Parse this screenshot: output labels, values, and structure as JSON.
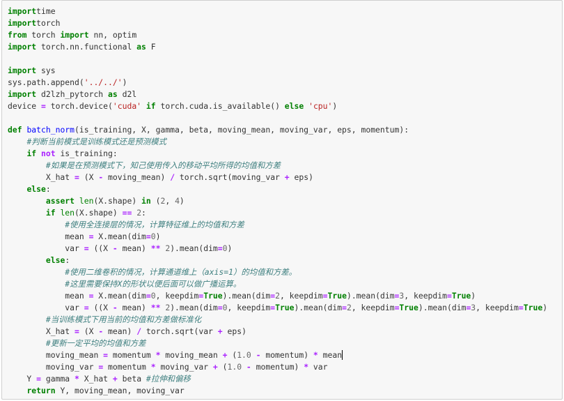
{
  "code_cell": {
    "lines": [
      [
        [
          "kw",
          "import"
        ],
        [
          "",
          "time"
        ]
      ],
      [
        [
          "kw",
          "import"
        ],
        [
          "",
          "torch"
        ]
      ],
      [
        [
          "kw",
          "from"
        ],
        [
          "",
          " torch "
        ],
        [
          "kw",
          "import"
        ],
        [
          "",
          " nn, optim"
        ]
      ],
      [
        [
          "kw",
          "import"
        ],
        [
          "",
          " torch.nn.functional "
        ],
        [
          "kw",
          "as"
        ],
        [
          "",
          " F"
        ]
      ],
      [],
      [
        [
          "kw",
          "import"
        ],
        [
          "",
          " sys"
        ]
      ],
      [
        [
          "",
          "sys.path.append("
        ],
        [
          "st",
          "'../../'"
        ],
        [
          "",
          ")"
        ]
      ],
      [
        [
          "kw",
          "import"
        ],
        [
          "",
          " d2lzh_pytorch "
        ],
        [
          "kw",
          "as"
        ],
        [
          "",
          " d2l"
        ]
      ],
      [
        [
          "",
          "device "
        ],
        [
          "op",
          "="
        ],
        [
          "",
          " torch.device("
        ],
        [
          "st",
          "'cuda'"
        ],
        [
          "",
          ""
        ],
        [
          "kw",
          " if"
        ],
        [
          "",
          " torch.cuda.is_available() "
        ],
        [
          "kw",
          "else"
        ],
        [
          "",
          " "
        ],
        [
          "st",
          "'cpu'"
        ],
        [
          "",
          ")"
        ]
      ],
      [],
      [
        [
          "kw",
          "def"
        ],
        [
          "",
          " "
        ],
        [
          "fn",
          "batch_norm"
        ],
        [
          "",
          "(is_training, X, gamma, beta, moving_mean, moving_var, eps, momentum):"
        ]
      ],
      [
        [
          "",
          "    "
        ],
        [
          "cm",
          "#判断当前模式是训练模式还是预测模式"
        ]
      ],
      [
        [
          "",
          "    "
        ],
        [
          "kw",
          "if"
        ],
        [
          "",
          " "
        ],
        [
          "op",
          "not"
        ],
        [
          "",
          " is_training:"
        ]
      ],
      [
        [
          "",
          "        "
        ],
        [
          "cm",
          "#如果是在预测模式下，知己使用传入的移动平均所得的均值和方差"
        ]
      ],
      [
        [
          "",
          "        X_hat "
        ],
        [
          "op",
          "="
        ],
        [
          "",
          " (X "
        ],
        [
          "op",
          "-"
        ],
        [
          "",
          " moving_mean) "
        ],
        [
          "op",
          "/"
        ],
        [
          "",
          " torch.sqrt(moving_var "
        ],
        [
          "op",
          "+"
        ],
        [
          "",
          " eps)"
        ]
      ],
      [
        [
          "",
          "    "
        ],
        [
          "kw",
          "else"
        ],
        [
          "",
          ":"
        ]
      ],
      [
        [
          "",
          "        "
        ],
        [
          "kw",
          "assert"
        ],
        [
          "",
          " "
        ],
        [
          "bi",
          "len"
        ],
        [
          "",
          "(X.shape) "
        ],
        [
          "kw",
          "in"
        ],
        [
          "",
          " ("
        ],
        [
          "nm",
          "2"
        ],
        [
          "",
          ", "
        ],
        [
          "nm",
          "4"
        ],
        [
          "",
          ")"
        ]
      ],
      [
        [
          "",
          "        "
        ],
        [
          "kw",
          "if"
        ],
        [
          "",
          " "
        ],
        [
          "bi",
          "len"
        ],
        [
          "",
          "(X.shape) "
        ],
        [
          "op",
          "=="
        ],
        [
          "",
          " "
        ],
        [
          "nm",
          "2"
        ],
        [
          "",
          ":"
        ]
      ],
      [
        [
          "",
          "            "
        ],
        [
          "cm",
          "#使用全连接层的情况，计算特征维上的均值和方差"
        ]
      ],
      [
        [
          "",
          "            mean "
        ],
        [
          "op",
          "="
        ],
        [
          "",
          " X.mean(dim"
        ],
        [
          "op",
          "="
        ],
        [
          "nm",
          "0"
        ],
        [
          "",
          ")"
        ]
      ],
      [
        [
          "",
          "            var "
        ],
        [
          "op",
          "="
        ],
        [
          "",
          " ((X "
        ],
        [
          "op",
          "-"
        ],
        [
          "",
          " mean) "
        ],
        [
          "op",
          "**"
        ],
        [
          "",
          " "
        ],
        [
          "nm",
          "2"
        ],
        [
          "",
          ").mean(dim"
        ],
        [
          "op",
          "="
        ],
        [
          "nm",
          "0"
        ],
        [
          "",
          ")"
        ]
      ],
      [
        [
          "",
          "        "
        ],
        [
          "kw",
          "else"
        ],
        [
          "",
          ":"
        ]
      ],
      [
        [
          "",
          "            "
        ],
        [
          "cm",
          "#使用二维卷积的情况，计算通道维上（axis=1）的均值和方差。"
        ]
      ],
      [
        [
          "",
          "            "
        ],
        [
          "cm",
          "#这里需要保持X的形状以便后面可以做广播运算。"
        ]
      ],
      [
        [
          "",
          "            mean "
        ],
        [
          "op",
          "="
        ],
        [
          "",
          " X.mean(dim"
        ],
        [
          "op",
          "="
        ],
        [
          "nm",
          "0"
        ],
        [
          "",
          ", keepdim"
        ],
        [
          "op",
          "="
        ],
        [
          "kw",
          "True"
        ],
        [
          "",
          ").mean(dim"
        ],
        [
          "op",
          "="
        ],
        [
          "nm",
          "2"
        ],
        [
          "",
          ", keepdim"
        ],
        [
          "op",
          "="
        ],
        [
          "kw",
          "True"
        ],
        [
          "",
          ").mean(dim"
        ],
        [
          "op",
          "="
        ],
        [
          "nm",
          "3"
        ],
        [
          "",
          ", keepdim"
        ],
        [
          "op",
          "="
        ],
        [
          "kw",
          "True"
        ],
        [
          "",
          ")"
        ]
      ],
      [
        [
          "",
          "            var "
        ],
        [
          "op",
          "="
        ],
        [
          "",
          " ((X "
        ],
        [
          "op",
          "-"
        ],
        [
          "",
          " mean) "
        ],
        [
          "op",
          "**"
        ],
        [
          "",
          " "
        ],
        [
          "nm",
          "2"
        ],
        [
          "",
          ").mean(dim"
        ],
        [
          "op",
          "="
        ],
        [
          "nm",
          "0"
        ],
        [
          "",
          ", keepdim"
        ],
        [
          "op",
          "="
        ],
        [
          "kw",
          "True"
        ],
        [
          "",
          ").mean(dim"
        ],
        [
          "op",
          "="
        ],
        [
          "nm",
          "2"
        ],
        [
          "",
          ", keepdim"
        ],
        [
          "op",
          "="
        ],
        [
          "kw",
          "True"
        ],
        [
          "",
          ").mean(dim"
        ],
        [
          "op",
          "="
        ],
        [
          "nm",
          "3"
        ],
        [
          "",
          ", keepdim"
        ],
        [
          "op",
          "="
        ],
        [
          "kw",
          "True"
        ],
        [
          "",
          ")"
        ]
      ],
      [
        [
          "",
          "        "
        ],
        [
          "cm",
          "#当训练模式下用当前的均值和方差做标准化"
        ]
      ],
      [
        [
          "",
          "        X_hat "
        ],
        [
          "op",
          "="
        ],
        [
          "",
          " (X "
        ],
        [
          "op",
          "-"
        ],
        [
          "",
          " mean) "
        ],
        [
          "op",
          "/"
        ],
        [
          "",
          " torch.sqrt(var "
        ],
        [
          "op",
          "+"
        ],
        [
          "",
          " eps)"
        ]
      ],
      [
        [
          "",
          "        "
        ],
        [
          "cm",
          "#更新一定平均的均值和方差"
        ]
      ],
      [
        [
          "",
          "        moving_mean "
        ],
        [
          "op",
          "="
        ],
        [
          "",
          " momentum "
        ],
        [
          "op",
          "*"
        ],
        [
          "",
          " moving_mean "
        ],
        [
          "op",
          "+"
        ],
        [
          "",
          " ("
        ],
        [
          "nm",
          "1.0"
        ],
        [
          "",
          " "
        ],
        [
          "op",
          "-"
        ],
        [
          "",
          " momentum) "
        ],
        [
          "op",
          "*"
        ],
        [
          "",
          " mean"
        ]
      ],
      [
        [
          "",
          "        moving_var "
        ],
        [
          "op",
          "="
        ],
        [
          "",
          " momentum "
        ],
        [
          "op",
          "*"
        ],
        [
          "",
          " moving_var "
        ],
        [
          "op",
          "+"
        ],
        [
          "",
          " ("
        ],
        [
          "nm",
          "1.0"
        ],
        [
          "",
          " "
        ],
        [
          "op",
          "-"
        ],
        [
          "",
          " momentum) "
        ],
        [
          "op",
          "*"
        ],
        [
          "",
          " var"
        ]
      ],
      [
        [
          "",
          "    Y "
        ],
        [
          "op",
          "="
        ],
        [
          "",
          " gamma "
        ],
        [
          "op",
          "*"
        ],
        [
          "",
          " X_hat "
        ],
        [
          "op",
          "+"
        ],
        [
          "",
          " beta "
        ],
        [
          "cm",
          "#拉伸和偏移"
        ]
      ],
      [
        [
          "",
          "    "
        ],
        [
          "kw",
          "return"
        ],
        [
          "",
          " Y, moving_mean, moving_var"
        ]
      ]
    ],
    "cursor_line": 29
  }
}
